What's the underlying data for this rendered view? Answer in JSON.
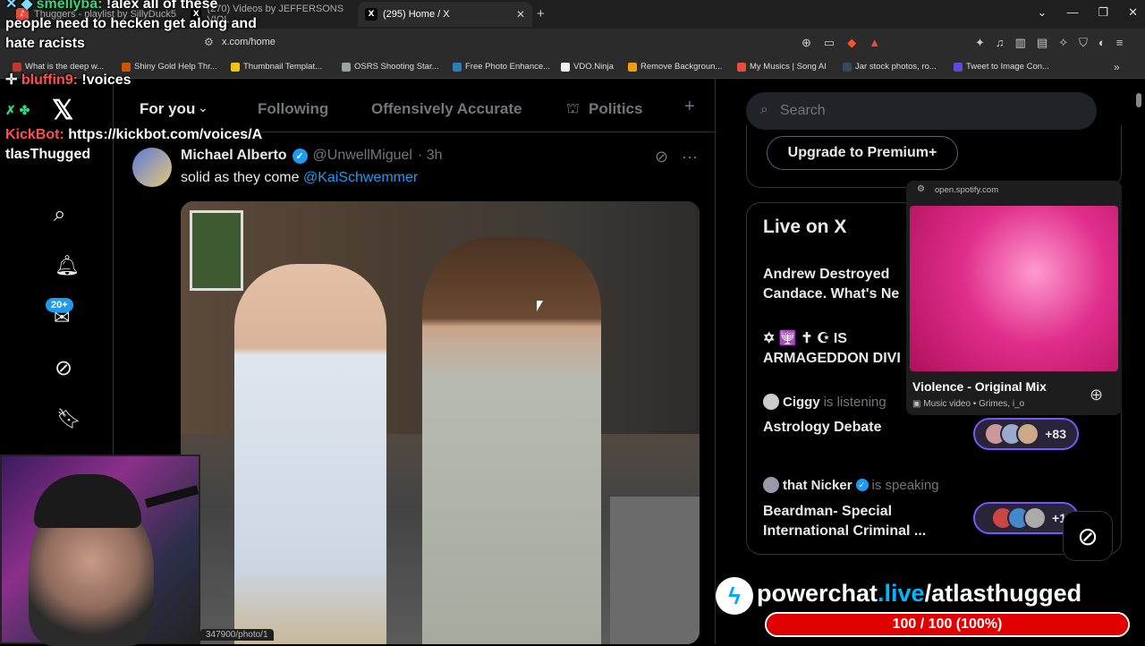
{
  "browser": {
    "tabs": [
      {
        "title": "Thuggers - playlist by SillyDuck5",
        "active": false
      },
      {
        "title": "(270) Videos by JEFFERSONS VIOL",
        "active": false
      },
      {
        "title": "(295) Home / X",
        "active": true
      }
    ],
    "new_tab": "+",
    "url": "x.com/home",
    "bookmarks": [
      {
        "label": "What is the deep w...",
        "color": "#c0392b"
      },
      {
        "label": "Shiny Gold Help Thr...",
        "color": "#d35400"
      },
      {
        "label": "Thumbnail Templat...",
        "color": "#f1c40f"
      },
      {
        "label": "OSRS Shooting Star...",
        "color": "#95a5a6"
      },
      {
        "label": "Free Photo Enhance...",
        "color": "#2980b9"
      },
      {
        "label": "VDO.Ninja",
        "color": "#ecf0f1"
      },
      {
        "label": "Remove Backgroun...",
        "color": "#f39c12"
      },
      {
        "label": "My Musics | Song AI",
        "color": "#e74c3c"
      },
      {
        "label": "Jar stock photos, ro...",
        "color": "#34495e"
      },
      {
        "label": "Tweet to Image Con...",
        "color": "#5b4bd6"
      }
    ]
  },
  "feed_tabs": [
    "For you",
    "Following",
    "Offensively Accurate",
    "Politics"
  ],
  "nav": {
    "badge": "20+"
  },
  "tweet": {
    "name": "Michael Alberto",
    "handle": "@UnwellMiguel",
    "time": "· 3h",
    "text": "solid as they come ",
    "mention": "@KaiSchwemmer",
    "photo_link": "347900/photo/1"
  },
  "sidebar": {
    "search_placeholder": "Search",
    "premium_button": "Upgrade to Premium+",
    "live_title": "Live on X",
    "spaces": [
      {
        "title": "Andrew Destroyed Candace. What's Ne"
      },
      {
        "title": "✡ 🕎 ✝ ☪ IS ARMAGEDDON DIVI"
      },
      {
        "user": "Ciggy",
        "status": "is listening",
        "title": "Astrology Debate",
        "count": "+83"
      },
      {
        "user": "that Nicker",
        "status": "is speaking",
        "title": "Beardman- Special International Criminal ...",
        "count": "+1"
      }
    ]
  },
  "spotify": {
    "source": "open.spotify.com",
    "title": "Violence - Original Mix",
    "subtitle": "Music video • Grimes, i_o"
  },
  "overlay": {
    "chat": [
      {
        "user": "smellyba:",
        "msg": " !alex all of these people need to hecken get along and hate racists"
      },
      {
        "user": "bluffin9:",
        "msg": " !voices"
      },
      {
        "user": "KickBot:",
        "msg": " https://kickbot.com/voices/AtlasThugged"
      }
    ],
    "powerchat_brand_a": "powerchat",
    "powerchat_brand_b": ".live",
    "powerchat_brand_c": "/atlasthugged",
    "progress_text": "100 / 100 (100%)",
    "progress_fraction": 1.0
  },
  "colors": {
    "accent": "#1d9bf0",
    "spaces_border": "#7856ff",
    "progress": "#e10000"
  }
}
